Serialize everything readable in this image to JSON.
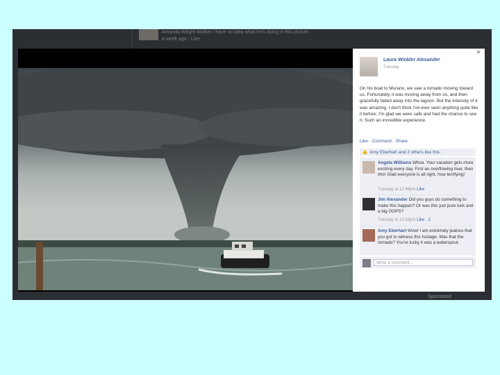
{
  "background_feed": {
    "line1": "Amanda Wright Walker I have no idea what he's doing in this picture.",
    "line2": "a week ago · Like",
    "bottom_text": "Sponsored"
  },
  "panel": {
    "close_label": "×",
    "author_name": "Laura Winkler Alexander",
    "post_date": "Tuesday",
    "post_text": "On his boat to Murano, we saw a tornado moving toward us. Fortunately, it was moving away from us, and then gracefully faded away into the lagoon. But the intensity of it was amazing. I don't think I've ever seen anything quite like it before; I'm glad we were safe and had the chance to see it. Such an incredible experience.",
    "actions": "Like · Comment · Share",
    "likes_text": "Amy Eberhart and 2 others like this.",
    "comments": [
      {
        "name": "Angela Williams",
        "text": "Whoa. Your vacation gets more exciting every day. First an overflowing river, then this! Glad everyone is all right, how terrifying!",
        "meta": "Tuesday at 12:46pm",
        "link": "Like"
      },
      {
        "name": "Jim Alexander",
        "text": "Did you guys do something to make this happen? Or was this just pure luck and a big OOPS?",
        "meta": "Tuesday at 12:53pm",
        "link": "Like · 2"
      },
      {
        "name": "Amy Eberhart",
        "text": "Wow! I am extremely jealous that you got to witness this footage. Was that the tornado? You're lucky it was a waterspout.",
        "meta": "",
        "link": ""
      }
    ],
    "comment_placeholder": "Write a comment..."
  }
}
